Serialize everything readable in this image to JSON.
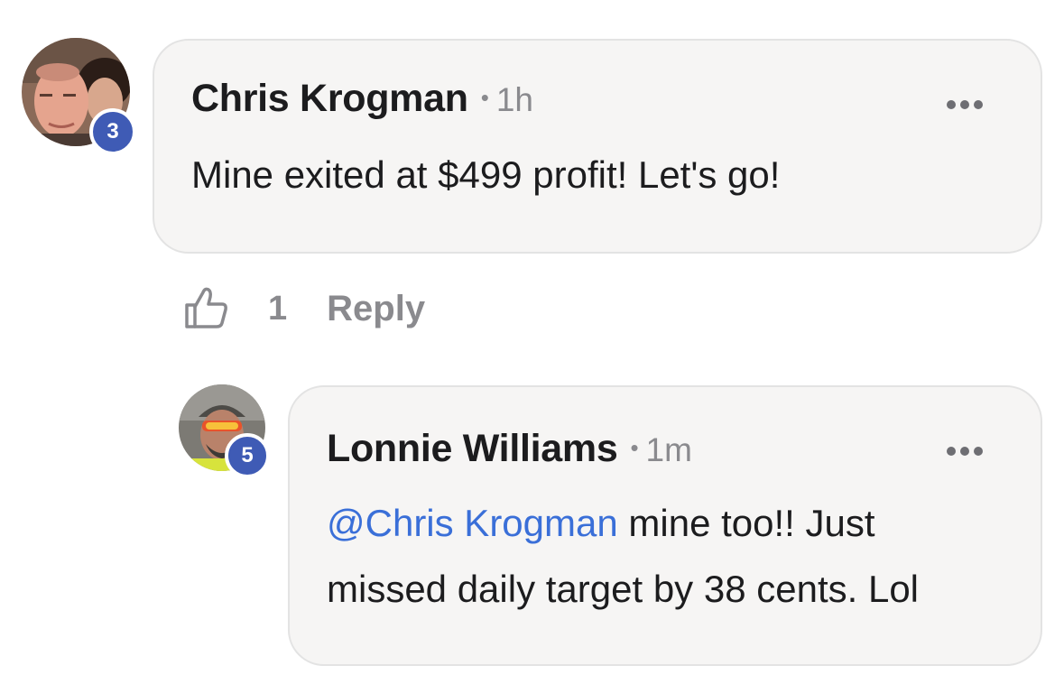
{
  "comments": [
    {
      "author": "Chris Krogman",
      "time": "1h",
      "badge": "3",
      "text": "Mine exited at $499 profit! Let's go!",
      "likes": "1",
      "reply_label": "Reply",
      "separator": "•"
    },
    {
      "author": "Lonnie Williams",
      "time": "1m",
      "badge": "5",
      "mention": "@Chris Krogman",
      "text_line1": " mine too!! Just",
      "text_line2": "missed daily target by 38 cents. Lol",
      "separator": "•"
    }
  ],
  "icons": {
    "like": "thumbs-up-icon",
    "more": "more-horizontal-icon"
  },
  "colors": {
    "badge": "#3f5bb5",
    "mention": "#3a6fd8",
    "bubble": "#f6f5f4",
    "muted": "#8a8a8e"
  }
}
